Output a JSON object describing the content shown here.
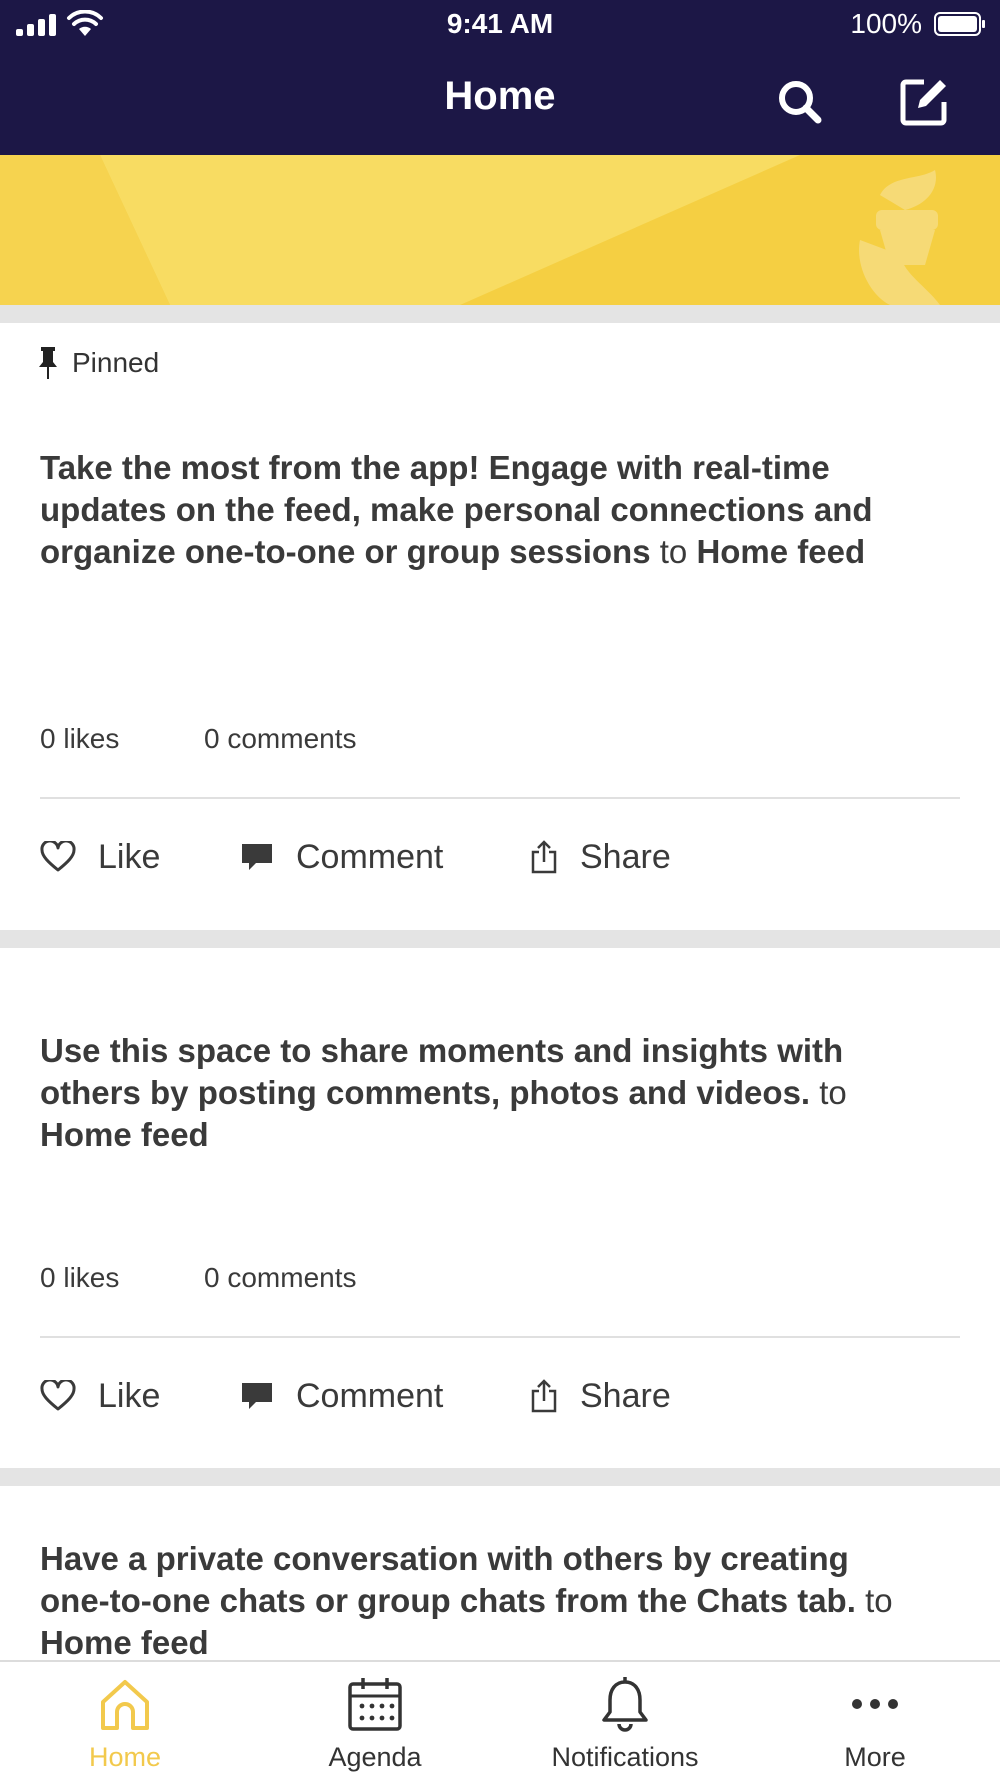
{
  "status_bar": {
    "time": "9:41 AM",
    "battery": "100%"
  },
  "header": {
    "title": "Home"
  },
  "colors": {
    "nav_bg": "#1c1746",
    "accent": "#f2c94c",
    "banner": "#f5cf42"
  },
  "pinned_label": "Pinned",
  "posts": [
    {
      "message": "Take the most from the app! Engage with real-time updates on the feed, make personal connections and organize one-to-one or group sessions",
      "to": "to",
      "feed": "Home feed",
      "likes": "0 likes",
      "comments": "0 comments"
    },
    {
      "message": "Use this space to share moments and insights with others by posting comments, photos and videos.",
      "to": "to",
      "feed": "Home feed",
      "likes": "0 likes",
      "comments": "0 comments"
    },
    {
      "message": "Have a private conversation with others by creating one-to-one chats or group chats from the Chats tab.",
      "to": "to",
      "feed": "Home feed"
    }
  ],
  "actions": {
    "like": "Like",
    "comment": "Comment",
    "share": "Share"
  },
  "tabbar": {
    "items": [
      {
        "label": "Home",
        "icon": "home-icon",
        "active": true
      },
      {
        "label": "Agenda",
        "icon": "calendar-icon",
        "active": false
      },
      {
        "label": "Notifications",
        "icon": "bell-icon",
        "active": false
      },
      {
        "label": "More",
        "icon": "more-icon",
        "active": false
      }
    ]
  }
}
